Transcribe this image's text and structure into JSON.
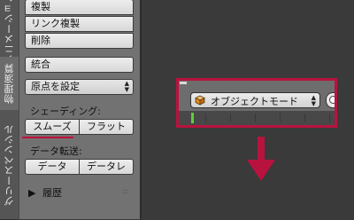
{
  "tabs": [
    {
      "label": "アニメーション"
    },
    {
      "label": "物理演算"
    },
    {
      "label": "グリースペンシル"
    }
  ],
  "panel": {
    "buttons_top": [
      "複製",
      "リンク複製",
      "削除"
    ],
    "join_label": "統合",
    "origin_dropdown": "原点を設定",
    "shading_label": "シェーディング:",
    "smooth_label": "スムーズ",
    "flat_label": "フラット",
    "data_transfer_label": "データ転送:",
    "data_label": "データ",
    "data_layer_label": "データレ",
    "history_label": "履歴"
  },
  "header": {
    "mode_label": "オブジェクトモード"
  },
  "colors": {
    "highlight": "#b8133f",
    "current_frame": "#5ccf3a"
  },
  "icons": [
    "cube-icon",
    "down-arrow-icon",
    "disclosure-triangle-icon",
    "grip-icon"
  ]
}
